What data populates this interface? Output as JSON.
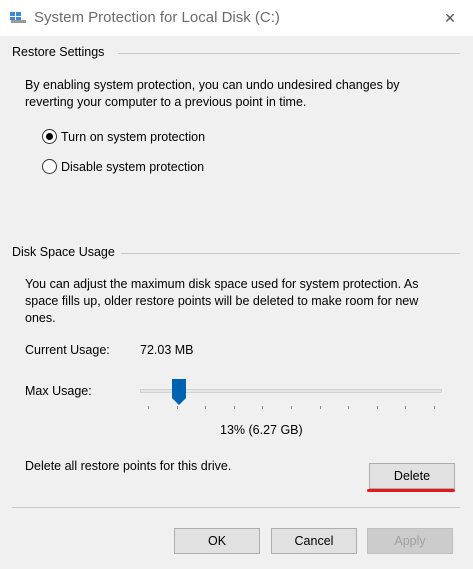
{
  "window": {
    "title": "System Protection for Local Disk (C:)",
    "close_glyph": "✕"
  },
  "restore_settings": {
    "header": "Restore Settings",
    "description_line1": "By enabling system protection, you can undo undesired changes by",
    "description_line2": "reverting your computer to a previous point in time.",
    "options": [
      {
        "label": "Turn on system protection",
        "selected": true
      },
      {
        "label": "Disable system protection",
        "selected": false
      }
    ]
  },
  "disk_space": {
    "header": "Disk Space Usage",
    "description_line1": "You can adjust the maximum disk space used for system protection. As",
    "description_line2": "space fills up, older restore points will be deleted to make room for new",
    "description_line3": "ones.",
    "current_usage_label": "Current Usage:",
    "current_usage_value": "72.03 MB",
    "max_usage_label": "Max Usage:",
    "max_usage_percent": 13,
    "max_usage_text": "13% (6.27 GB)",
    "delete_text": "Delete all restore points for this drive.",
    "delete_button": "Delete"
  },
  "buttons": {
    "ok": "OK",
    "cancel": "Cancel",
    "apply": "Apply"
  },
  "colors": {
    "accent": "#0063b1",
    "annotation": "#e21a1a"
  }
}
